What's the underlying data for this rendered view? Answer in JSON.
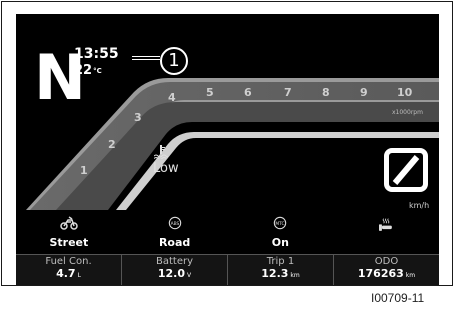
{
  "gear": "N",
  "clock": "13:55",
  "temperature": {
    "value": "22",
    "unit": "°C"
  },
  "callout": "1",
  "rpm": {
    "ticks": [
      "1",
      "2",
      "3",
      "4",
      "5",
      "6",
      "7",
      "8",
      "9",
      "10"
    ],
    "unit": "x1000rpm"
  },
  "coolant": {
    "icon": "coolant-temp-icon",
    "label": "Low"
  },
  "speed": {
    "unit": "km/h"
  },
  "modes": [
    {
      "icon": "motorcycle-icon",
      "label": "Street"
    },
    {
      "icon": "abs-icon",
      "icon_text": "ABS",
      "label": "Road"
    },
    {
      "icon": "mtc-icon",
      "icon_text": "MTC",
      "label": "On"
    },
    {
      "icon": "heated-grip-icon",
      "label": ""
    }
  ],
  "info": [
    {
      "title": "Fuel Con.",
      "value": "4.7",
      "unit": "L"
    },
    {
      "title": "Battery",
      "value": "12.0",
      "unit": "V"
    },
    {
      "title": "Trip 1",
      "value": "12.3",
      "unit": "km"
    },
    {
      "title": "ODO",
      "value": "176263",
      "unit": "km"
    }
  ],
  "figure_code": "I00709-11"
}
